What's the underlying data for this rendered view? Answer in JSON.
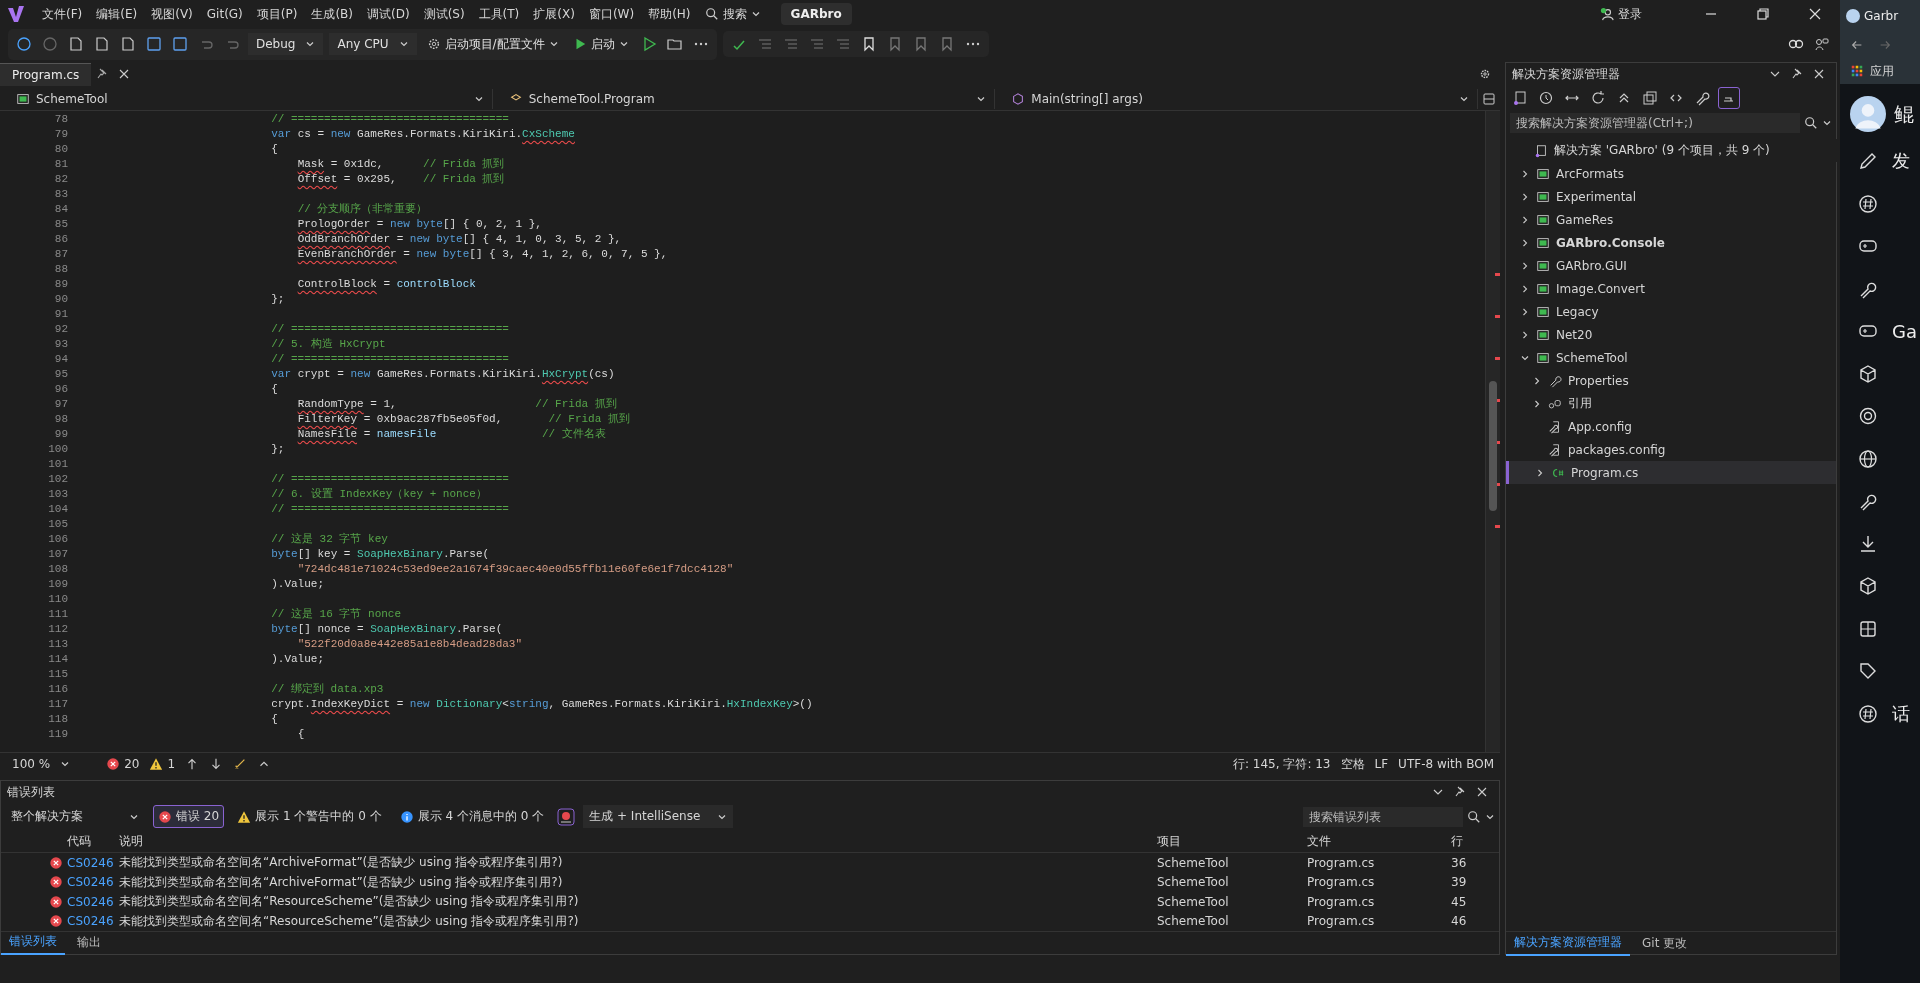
{
  "menu": {
    "items": [
      "文件(F)",
      "编辑(E)",
      "视图(V)",
      "Git(G)",
      "项目(P)",
      "生成(B)",
      "调试(D)",
      "测试(S)",
      "工具(T)",
      "扩展(X)",
      "窗口(W)",
      "帮助(H)"
    ],
    "search": "搜索",
    "solution_badge": "GARbro",
    "login": "登录"
  },
  "toolbar": {
    "configuration": "Debug",
    "platform": "Any CPU",
    "startup_project": "启动项目/配置文件",
    "start": "启动"
  },
  "document_tabs": [
    {
      "label": "Program.cs",
      "selected": true
    }
  ],
  "navigation": {
    "project": "SchemeTool",
    "type": "SchemeTool.Program",
    "member": "Main(string[] args)"
  },
  "code_lines": [
    {
      "no": "78",
      "code": [
        {
          "text": "            // =================================",
          "kind": "comment"
        }
      ]
    },
    {
      "no": "79",
      "code": [
        {
          "text": "            var",
          "kind": "kw"
        },
        {
          "text": " cs = ",
          "kind": "plain"
        },
        {
          "text": "new",
          "kind": "kw"
        },
        {
          "text": " GameRes.Formats.KiriKiri.",
          "kind": "plain"
        },
        {
          "text": "CxScheme",
          "kind": "errtype"
        }
      ]
    },
    {
      "no": "80",
      "code": [
        {
          "text": "            {",
          "kind": "plain"
        }
      ]
    },
    {
      "no": "81",
      "code": [
        {
          "text": "                Mask",
          "kind": "err"
        },
        {
          "text": " = 0x1dc,      ",
          "kind": "plain"
        },
        {
          "text": "// Frida 抓到",
          "kind": "comment"
        }
      ]
    },
    {
      "no": "82",
      "code": [
        {
          "text": "                Offset",
          "kind": "err"
        },
        {
          "text": " = 0x295,    ",
          "kind": "plain"
        },
        {
          "text": "// Frida 抓到",
          "kind": "comment"
        }
      ]
    },
    {
      "no": "83"
    },
    {
      "no": "84",
      "code": [
        {
          "text": "                // 分支顺序（非常重要）",
          "kind": "comment"
        }
      ]
    },
    {
      "no": "85",
      "code": [
        {
          "text": "                PrologOrder",
          "kind": "err"
        },
        {
          "text": " = ",
          "kind": "plain"
        },
        {
          "text": "new byte",
          "kind": "kw"
        },
        {
          "text": "[] { 0, 2, 1 },",
          "kind": "plain"
        }
      ]
    },
    {
      "no": "86",
      "code": [
        {
          "text": "                OddBranchOrder",
          "kind": "err"
        },
        {
          "text": " = ",
          "kind": "plain"
        },
        {
          "text": "new byte",
          "kind": "kw"
        },
        {
          "text": "[] { 4, 1, 0, 3, 5, 2 },",
          "kind": "plain"
        }
      ]
    },
    {
      "no": "87",
      "code": [
        {
          "text": "                EvenBranchOrder",
          "kind": "err"
        },
        {
          "text": " = ",
          "kind": "plain"
        },
        {
          "text": "new byte",
          "kind": "kw"
        },
        {
          "text": "[] { 3, 4, 1, 2, 6, 0, 7, 5 },",
          "kind": "plain"
        }
      ]
    },
    {
      "no": "88"
    },
    {
      "no": "89",
      "code": [
        {
          "text": "                ControlBlock",
          "kind": "err"
        },
        {
          "text": " = ",
          "kind": "plain"
        },
        {
          "text": "controlBlock",
          "kind": "var"
        }
      ]
    },
    {
      "no": "90",
      "code": [
        {
          "text": "            };",
          "kind": "plain"
        }
      ]
    },
    {
      "no": "91"
    },
    {
      "no": "92",
      "code": [
        {
          "text": "            // =================================",
          "kind": "comment"
        }
      ]
    },
    {
      "no": "93",
      "code": [
        {
          "text": "            // 5. 构造 HxCrypt",
          "kind": "comment"
        }
      ]
    },
    {
      "no": "94",
      "code": [
        {
          "text": "            // =================================",
          "kind": "comment"
        }
      ]
    },
    {
      "no": "95",
      "code": [
        {
          "text": "            var",
          "kind": "kw"
        },
        {
          "text": " crypt = ",
          "kind": "plain"
        },
        {
          "text": "new",
          "kind": "kw"
        },
        {
          "text": " GameRes.Formats.KiriKiri.",
          "kind": "plain"
        },
        {
          "text": "HxCrypt",
          "kind": "errtype"
        },
        {
          "text": "(cs)",
          "kind": "plain"
        }
      ]
    },
    {
      "no": "96",
      "code": [
        {
          "text": "            {",
          "kind": "plain"
        }
      ]
    },
    {
      "no": "97",
      "code": [
        {
          "text": "                RandomType",
          "kind": "err"
        },
        {
          "text": " = 1,                     ",
          "kind": "plain"
        },
        {
          "text": "// Frida 抓到",
          "kind": "comment"
        }
      ]
    },
    {
      "no": "98",
      "code": [
        {
          "text": "                FilterKey",
          "kind": "err"
        },
        {
          "text": " = 0xb9ac287fb5e05f0d,       ",
          "kind": "plain"
        },
        {
          "text": "// Frida 抓到",
          "kind": "comment"
        }
      ]
    },
    {
      "no": "99",
      "code": [
        {
          "text": "                NamesFile",
          "kind": "err"
        },
        {
          "text": " = ",
          "kind": "plain"
        },
        {
          "text": "namesFile",
          "kind": "var"
        },
        {
          "text": "                // 文件名表",
          "kind": "comment"
        }
      ]
    },
    {
      "no": "100",
      "code": [
        {
          "text": "            };",
          "kind": "plain"
        }
      ]
    },
    {
      "no": "101"
    },
    {
      "no": "102",
      "code": [
        {
          "text": "            // =================================",
          "kind": "comment"
        }
      ]
    },
    {
      "no": "103",
      "code": [
        {
          "text": "            // 6. 设置 IndexKey（key + nonce）",
          "kind": "comment"
        }
      ]
    },
    {
      "no": "104",
      "code": [
        {
          "text": "            // =================================",
          "kind": "comment"
        }
      ]
    },
    {
      "no": "105"
    },
    {
      "no": "106",
      "code": [
        {
          "text": "            // 这是 32 字节 key",
          "kind": "comment"
        }
      ]
    },
    {
      "no": "107",
      "code": [
        {
          "text": "            byte",
          "kind": "kw"
        },
        {
          "text": "[] key = ",
          "kind": "plain"
        },
        {
          "text": "SoapHexBinary",
          "kind": "type"
        },
        {
          "text": ".Parse(",
          "kind": "plain"
        }
      ]
    },
    {
      "no": "108",
      "code": [
        {
          "text": "                \"724dc481e71024c53ed9ee2a1674f39caec40e0d55ffb11e60fe6e1f7dcc4128\"",
          "kind": "string"
        }
      ]
    },
    {
      "no": "109",
      "code": [
        {
          "text": "            ).Value;",
          "kind": "plain"
        }
      ]
    },
    {
      "no": "110"
    },
    {
      "no": "111",
      "code": [
        {
          "text": "            // 这是 16 字节 nonce",
          "kind": "comment"
        }
      ]
    },
    {
      "no": "112",
      "code": [
        {
          "text": "            byte",
          "kind": "kw"
        },
        {
          "text": "[] nonce = ",
          "kind": "plain"
        },
        {
          "text": "SoapHexBinary",
          "kind": "type"
        },
        {
          "text": ".Parse(",
          "kind": "plain"
        }
      ]
    },
    {
      "no": "113",
      "code": [
        {
          "text": "                \"522f20d0a8e442e85a1e8b4dead28da3\"",
          "kind": "string"
        }
      ]
    },
    {
      "no": "114",
      "code": [
        {
          "text": "            ).Value;",
          "kind": "plain"
        }
      ]
    },
    {
      "no": "115"
    },
    {
      "no": "116",
      "code": [
        {
          "text": "            // 绑定到 data.xp3",
          "kind": "comment"
        }
      ]
    },
    {
      "no": "117",
      "code": [
        {
          "text": "            crypt.",
          "kind": "plain"
        },
        {
          "text": "IndexKeyDict",
          "kind": "err"
        },
        {
          "text": " = ",
          "kind": "plain"
        },
        {
          "text": "new",
          "kind": "kw"
        },
        {
          "text": " Dictionary",
          "kind": "type"
        },
        {
          "text": "<",
          "kind": "plain"
        },
        {
          "text": "string",
          "kind": "kw"
        },
        {
          "text": ", GameRes.Formats.KiriKiri.",
          "kind": "plain"
        },
        {
          "text": "HxIndexKey",
          "kind": "type"
        },
        {
          "text": ">()",
          "kind": "plain"
        }
      ]
    },
    {
      "no": "118",
      "code": [
        {
          "text": "            {",
          "kind": "plain"
        }
      ]
    },
    {
      "no": "119",
      "code": [
        {
          "text": "                {",
          "kind": "plain"
        }
      ]
    }
  ],
  "editor_status": {
    "zoom": "100 %",
    "errors": "20",
    "warnings": "1",
    "position": "行: 145, 字符: 13",
    "indent": "空格",
    "line_ending": "LF",
    "encoding": "UTF-8 with BOM"
  },
  "error_list": {
    "title": "错误列表",
    "scope": "整个解决方案",
    "filters": [
      {
        "kind": "error",
        "label": "错误 20",
        "selected": true
      },
      {
        "kind": "warning",
        "label": "展示 1 个警告中的 0 个",
        "selected": false
      },
      {
        "kind": "info",
        "label": "展示 4 个消息中的 0 个",
        "selected": false
      }
    ],
    "source": "生成 + IntelliSense",
    "search": {
      "placeholder": "搜索错误列表"
    },
    "columns": [
      "代码",
      "说明",
      "项目",
      "文件",
      "行"
    ],
    "rows": [
      {
        "code": "CS0246",
        "description": "未能找到类型或命名空间名“ArchiveFormat”(是否缺少 using 指令或程序集引用?)",
        "project": "SchemeTool",
        "file": "Program.cs",
        "line": "36"
      },
      {
        "code": "CS0246",
        "description": "未能找到类型或命名空间名“ArchiveFormat”(是否缺少 using 指令或程序集引用?)",
        "project": "SchemeTool",
        "file": "Program.cs",
        "line": "39"
      },
      {
        "code": "CS0246",
        "description": "未能找到类型或命名空间名“ResourceScheme”(是否缺少 using 指令或程序集引用?)",
        "project": "SchemeTool",
        "file": "Program.cs",
        "line": "45"
      },
      {
        "code": "CS0246",
        "description": "未能找到类型或命名空间名“ResourceScheme”(是否缺少 using 指令或程序集引用?)",
        "project": "SchemeTool",
        "file": "Program.cs",
        "line": "46"
      }
    ]
  },
  "bottom_tabs": [
    {
      "label": "错误列表",
      "selected": true
    },
    {
      "label": "输出",
      "selected": false
    }
  ],
  "solution_explorer": {
    "title": "解决方案资源管理器",
    "search": {
      "placeholder": "搜索解决方案资源管理器(Ctrl+;)"
    },
    "root": {
      "label": "解决方案 'GARbro' (9 个项目，共 9 个)",
      "children": [
        {
          "label": "ArcFormats",
          "kind": "project",
          "expanded": false,
          "bold": false,
          "selected": false
        },
        {
          "label": "Experimental",
          "kind": "project",
          "expanded": false,
          "bold": false,
          "selected": false
        },
        {
          "label": "GameRes",
          "kind": "project",
          "expanded": false,
          "bold": false,
          "selected": false
        },
        {
          "label": "GARbro.Console",
          "kind": "project",
          "expanded": false,
          "bold": true,
          "selected": false
        },
        {
          "label": "GARbro.GUI",
          "kind": "project",
          "expanded": false,
          "bold": false,
          "selected": false
        },
        {
          "label": "Image.Convert",
          "kind": "project",
          "expanded": false,
          "bold": false,
          "selected": false
        },
        {
          "label": "Legacy",
          "kind": "project",
          "expanded": false,
          "bold": false,
          "selected": false
        },
        {
          "label": "Net20",
          "kind": "project",
          "expanded": false,
          "bold": false,
          "selected": false
        },
        {
          "label": "SchemeTool",
          "kind": "project",
          "expanded": true,
          "bold": false,
          "selected": false,
          "children": [
            {
              "label": "Properties",
              "kind": "properties",
              "expanded": false,
              "bold": false,
              "selected": false
            },
            {
              "label": "引用",
              "kind": "references",
              "expanded": false,
              "bold": false,
              "selected": false
            },
            {
              "label": "App.config",
              "kind": "config",
              "bold": false,
              "selected": false
            },
            {
              "label": "packages.config",
              "kind": "config",
              "bold": false,
              "selected": false
            },
            {
              "label": "Program.cs",
              "kind": "csharp",
              "expanded": false,
              "bold": false,
              "selected": true
            }
          ]
        }
      ]
    }
  },
  "side_tabs": [
    {
      "label": "解决方案资源管理器",
      "selected": true
    },
    {
      "label": "Git 更改",
      "selected": false
    }
  ],
  "browser": {
    "tab": "Garbr",
    "bookmark": "应用",
    "profile_name": "鲲",
    "menu": [
      {
        "kind": "pencil",
        "label": "发"
      },
      {
        "kind": "hash"
      },
      {
        "kind": "gamepad"
      },
      {
        "kind": "wrench"
      },
      {
        "kind": "gamepad",
        "label": "Ga"
      },
      {
        "kind": "cube"
      },
      {
        "kind": "target"
      },
      {
        "kind": "globe"
      },
      {
        "kind": "wrench"
      },
      {
        "kind": "download"
      },
      {
        "kind": "cube"
      },
      {
        "kind": "grid"
      },
      {
        "kind": "tag"
      },
      {
        "kind": "hash",
        "label": "话"
      }
    ]
  }
}
